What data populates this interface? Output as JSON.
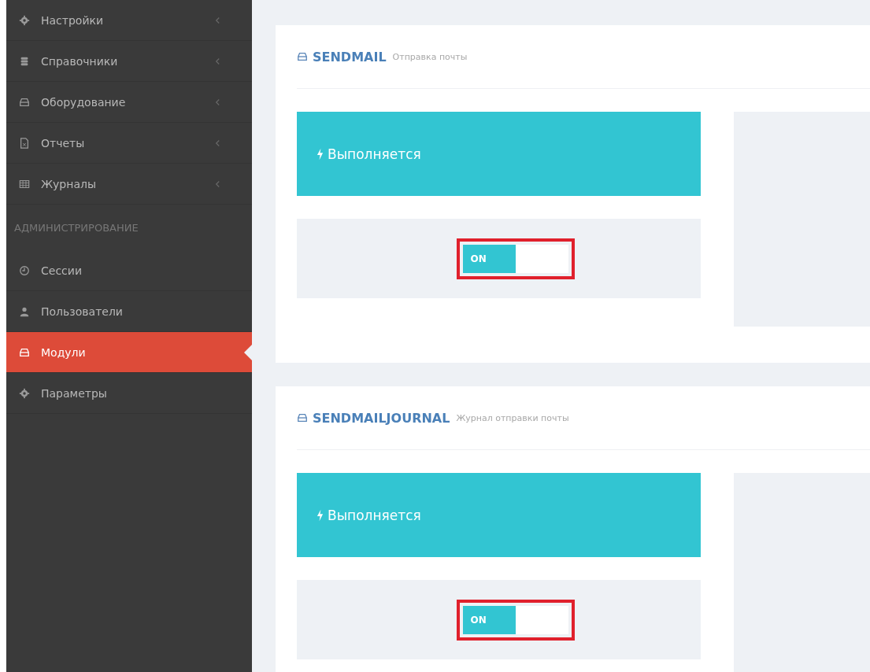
{
  "sidebar": {
    "items": [
      {
        "kind": "item",
        "label": "Настройки",
        "expandable": true,
        "selected": false
      },
      {
        "kind": "item",
        "label": "Справочники",
        "expandable": true,
        "selected": false
      },
      {
        "kind": "item",
        "label": "Оборудование",
        "expandable": true,
        "selected": false
      },
      {
        "kind": "item",
        "label": "Отчеты",
        "expandable": true,
        "selected": false
      },
      {
        "kind": "item",
        "label": "Журналы",
        "expandable": true,
        "selected": false
      },
      {
        "kind": "header",
        "label": "АДМИНИСТРИРОВАНИЕ"
      },
      {
        "kind": "item",
        "label": "Сессии",
        "expandable": false,
        "selected": false
      },
      {
        "kind": "item",
        "label": "Пользователи",
        "expandable": false,
        "selected": false
      },
      {
        "kind": "item",
        "label": "Модули",
        "expandable": false,
        "selected": true
      },
      {
        "kind": "item",
        "label": "Параметры",
        "expandable": false,
        "selected": false
      }
    ]
  },
  "modules": [
    {
      "name": "SENDMAIL",
      "description": "Отправка почты",
      "status": "Выполняется",
      "toggle": {
        "label": "ON",
        "on": true,
        "highlighted": true
      }
    },
    {
      "name": "SENDMAILJOURNAL",
      "description": "Журнал отправки почты",
      "status": "Выполняется",
      "toggle": {
        "label": "ON",
        "on": true,
        "highlighted": true
      }
    }
  ]
}
